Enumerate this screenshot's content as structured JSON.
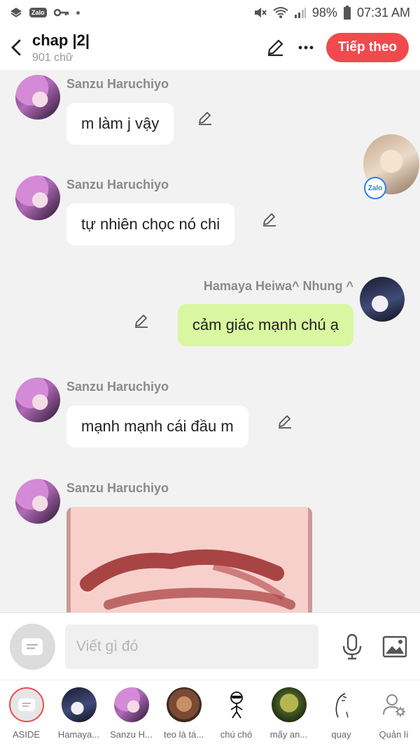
{
  "status_bar": {
    "zalo_label": "Zalo",
    "battery": "98%",
    "time": "07:31 AM"
  },
  "header": {
    "title": "chap |2|",
    "subtitle": "901 chữ",
    "next_button": "Tiếp theo"
  },
  "messages": [
    {
      "sender": "Sanzu Haruchiyo",
      "text": "m làm j vậy",
      "side": "left"
    },
    {
      "sender": "Sanzu Haruchiyo",
      "text": "tự nhiên chọc nó chi",
      "side": "left"
    },
    {
      "sender": "Hamaya Heiwa^ Nhung ^",
      "text": "cảm giác mạnh chú ạ",
      "side": "right"
    },
    {
      "sender": "Sanzu Haruchiyo",
      "text": "mạnh mạnh cái đầu m",
      "side": "left"
    },
    {
      "sender": "Sanzu Haruchiyo",
      "text": "",
      "side": "left",
      "type": "image"
    }
  ],
  "floating_badge": "Zalo",
  "composer": {
    "placeholder": "Viết gì đó"
  },
  "characters": [
    {
      "label": "ASIDE",
      "icon": "aside-icon"
    },
    {
      "label": "Hamaya...",
      "icon": "avatar"
    },
    {
      "label": "Sanzu H...",
      "icon": "avatar"
    },
    {
      "label": "teo là tá...",
      "icon": "avatar"
    },
    {
      "label": "chú chó",
      "icon": "avatar"
    },
    {
      "label": "mấy an...",
      "icon": "avatar"
    },
    {
      "label": "quay",
      "icon": "avatar"
    },
    {
      "label": "Quản lí",
      "icon": "manage-user-icon"
    }
  ],
  "colors": {
    "accent": "#f04a4e",
    "outgoing_bubble": "#d9f7a0",
    "incoming_bubble": "#ffffff"
  }
}
